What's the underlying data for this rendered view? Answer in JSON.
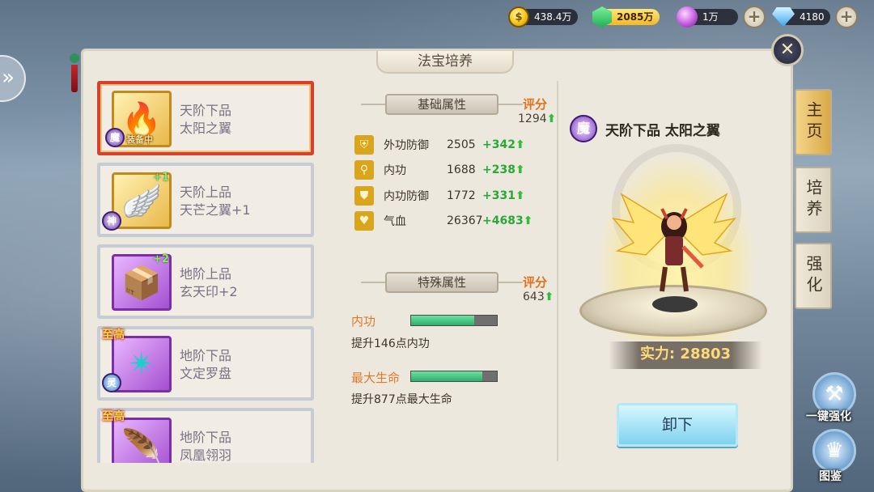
{
  "resources": {
    "gold": "438.4万",
    "jade": "2085万",
    "orb": "1万",
    "diamond": "4180"
  },
  "panel": {
    "title": "法宝培养",
    "close": "✕"
  },
  "treasure_list": [
    {
      "grade": "天阶下品",
      "name": "太阳之翼",
      "badge": "魔",
      "equip_label": "装备中",
      "plus": "",
      "top_badge": "",
      "icon": "🔥"
    },
    {
      "grade": "天阶上品",
      "name": "天芒之翼+1",
      "badge": "神",
      "equip_label": "",
      "plus": "+1",
      "top_badge": "",
      "icon": "🪽"
    },
    {
      "grade": "地阶上品",
      "name": "玄天印+2",
      "badge": "",
      "equip_label": "",
      "plus": "+2",
      "top_badge": "",
      "icon": "📦"
    },
    {
      "grade": "地阶下品",
      "name": "文定罗盘",
      "badge": "灵",
      "equip_label": "",
      "plus": "",
      "top_badge": "至高",
      "icon": "✴"
    },
    {
      "grade": "地阶下品",
      "name": "凤凰翎羽",
      "badge": "",
      "equip_label": "",
      "plus": "",
      "top_badge": "至高",
      "icon": "🪶"
    }
  ],
  "basic": {
    "title": "基础属性",
    "score_label": "评分",
    "score": "1294",
    "stats": [
      {
        "name": "外功防御",
        "value": "2505",
        "add": "+342",
        "icon": "shirt"
      },
      {
        "name": "内功",
        "value": "1688",
        "add": "+238",
        "icon": "wand"
      },
      {
        "name": "内功防御",
        "value": "1772",
        "add": "+331",
        "icon": "shield"
      },
      {
        "name": "气血",
        "value": "26367",
        "add": "+4683",
        "icon": "heart"
      }
    ]
  },
  "special": {
    "title": "特殊属性",
    "score_label": "评分",
    "score": "643",
    "attrs": [
      {
        "name": "内功",
        "desc": "提升146点内功",
        "progress": 0.74
      },
      {
        "name": "最大生命",
        "desc": "提升877点最大生命",
        "progress": 0.83
      }
    ]
  },
  "preview": {
    "badge": "魔",
    "name": "天阶下品 太阳之翼",
    "power_label": "实力:",
    "power": "28803",
    "unequip": "卸下"
  },
  "tabs": [
    "主页",
    "培养",
    "强化"
  ],
  "actions": {
    "one_key": "一键强化",
    "atlas": "图鉴"
  },
  "colors": {
    "accent_orange": "#e0721c",
    "stat_green": "#29a83a",
    "selected_border": "#d6402e"
  }
}
